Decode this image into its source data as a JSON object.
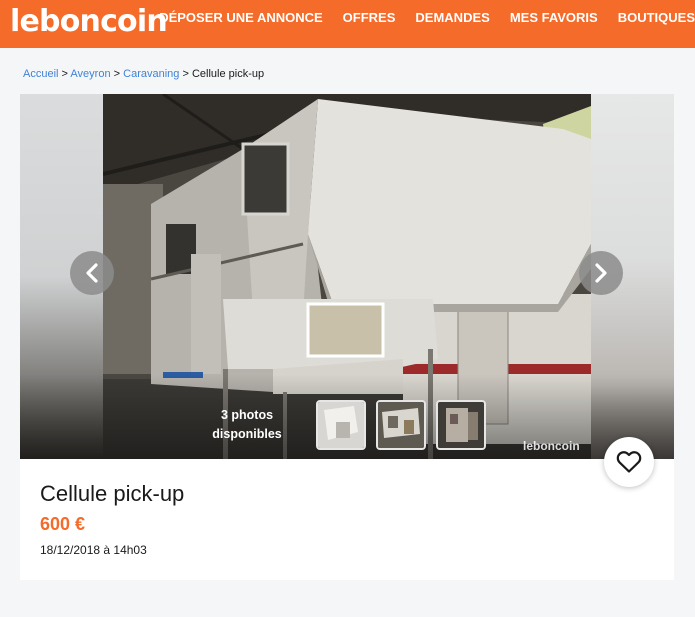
{
  "header": {
    "logo": "leboncoin",
    "nav": [
      "DÉPOSER UNE ANNONCE",
      "OFFRES",
      "DEMANDES",
      "MES FAVORIS",
      "BOUTIQUES"
    ]
  },
  "breadcrumb": {
    "items": [
      "Accueil",
      "Aveyron",
      "Caravaning"
    ],
    "separator": ">",
    "current": "Cellule pick-up"
  },
  "gallery": {
    "photo_count_line1": "3 photos",
    "photo_count_line2": "disponibles",
    "watermark": "leboncoin",
    "thumbnails": [
      "thumbnail-1",
      "thumbnail-2",
      "thumbnail-3"
    ]
  },
  "ad": {
    "title": "Cellule pick-up",
    "price": "600 €",
    "date": "18/12/2018 à 14h03"
  },
  "icons": {
    "prev": "chevron-left-icon",
    "next": "chevron-right-icon",
    "favorite": "heart-icon"
  },
  "colors": {
    "brand": "#f56b2a",
    "link": "#4183d7"
  }
}
